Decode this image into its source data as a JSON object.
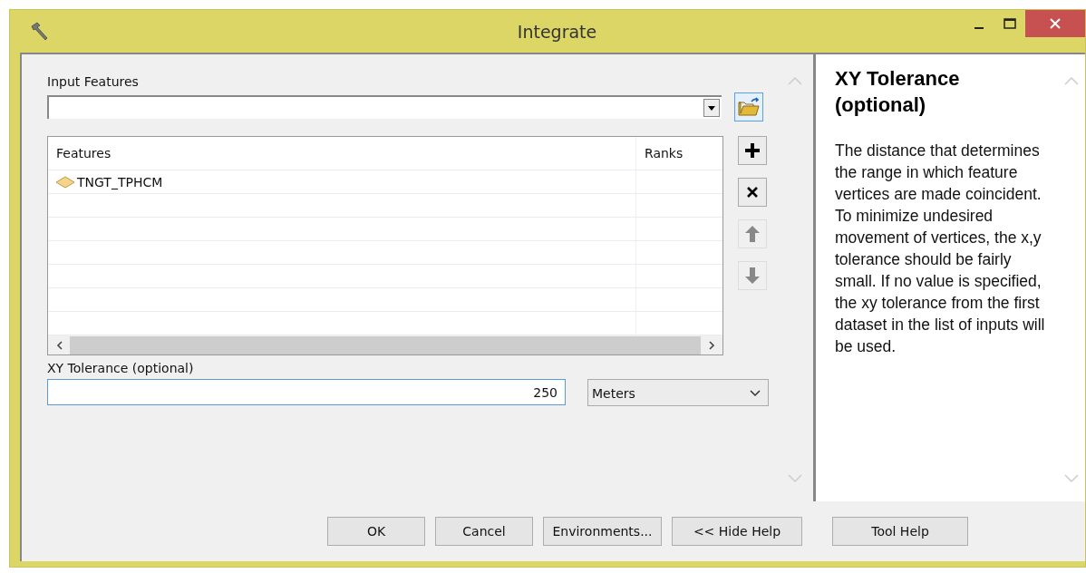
{
  "window": {
    "title": "Integrate"
  },
  "input_features": {
    "label": "Input Features",
    "value_list": {
      "columns": [
        "Features",
        "Ranks"
      ],
      "rows": [
        {
          "name": "TNGT_TPHCM"
        }
      ]
    }
  },
  "list_buttons": [
    {
      "kind": "add",
      "disabled": false
    },
    {
      "kind": "remove",
      "disabled": false
    },
    {
      "kind": "up",
      "disabled": true
    },
    {
      "kind": "down",
      "disabled": true
    }
  ],
  "xy_tolerance": {
    "label": "XY Tolerance (optional)",
    "value": "250",
    "unit": "Meters"
  },
  "help": {
    "title": "XY Tolerance (optional)",
    "text": "The distance that determines the range in which feature vertices are made coincident. To minimize undesired movement of vertices, the x,y tolerance should be fairly small. If no value is specified, the xy tolerance from the first dataset in the list of inputs will be used."
  },
  "buttons": [
    "OK",
    "Cancel",
    "Environments...",
    "<< Hide Help",
    "Tool Help"
  ]
}
